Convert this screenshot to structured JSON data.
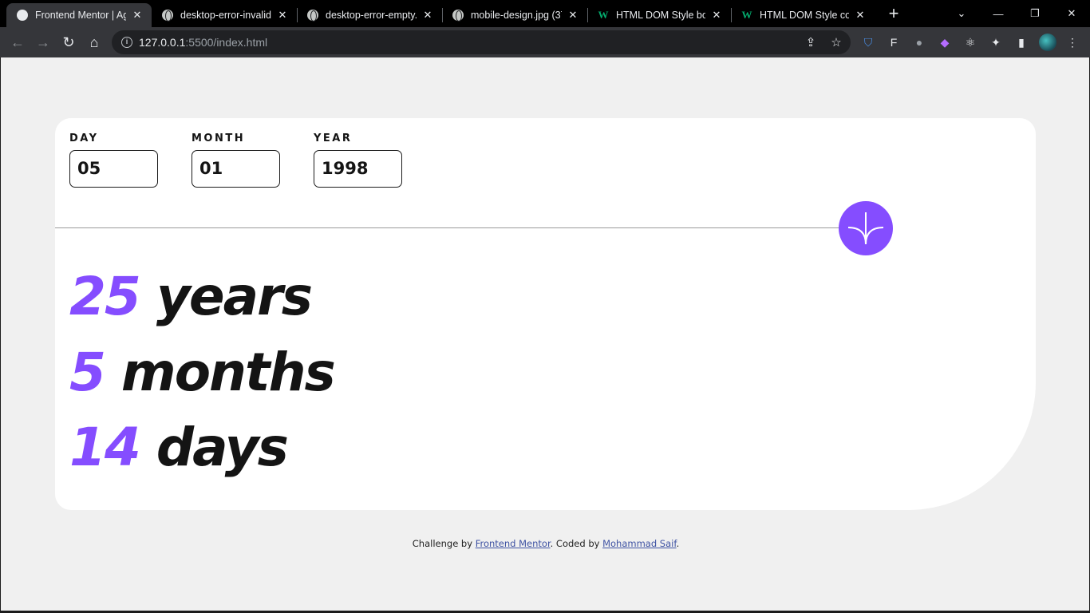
{
  "browser": {
    "tabs": [
      {
        "title": "Frontend Mentor | Age",
        "icon": "frontend-mentor-favicon",
        "active": true
      },
      {
        "title": "desktop-error-invalid.j",
        "icon": "globe-icon",
        "active": false
      },
      {
        "title": "desktop-error-empty.jp",
        "icon": "globe-icon",
        "active": false
      },
      {
        "title": "mobile-design.jpg (37",
        "icon": "globe-icon",
        "active": false
      },
      {
        "title": "HTML DOM Style borde",
        "icon": "w3schools-favicon",
        "active": false
      },
      {
        "title": "HTML DOM Style colo",
        "icon": "w3schools-favicon",
        "active": false
      }
    ],
    "url_host": "127.0.0.1",
    "url_rest": ":5500/index.html"
  },
  "form": {
    "day": {
      "label": "DAY",
      "value": "05"
    },
    "month": {
      "label": "MONTH",
      "value": "01"
    },
    "year": {
      "label": "YEAR",
      "value": "1998"
    }
  },
  "results": {
    "years": {
      "value": "25",
      "unit": "years"
    },
    "months": {
      "value": "5",
      "unit": "months"
    },
    "days": {
      "value": "14",
      "unit": "days"
    }
  },
  "footer": {
    "prefix": "Challenge by ",
    "link1": "Frontend Mentor",
    "middle": ". Coded by ",
    "link2": "Mohammad Saif",
    "suffix": "."
  },
  "colors": {
    "accent": "#854dff",
    "ink": "#141414",
    "page_bg": "#f0f0f0"
  }
}
